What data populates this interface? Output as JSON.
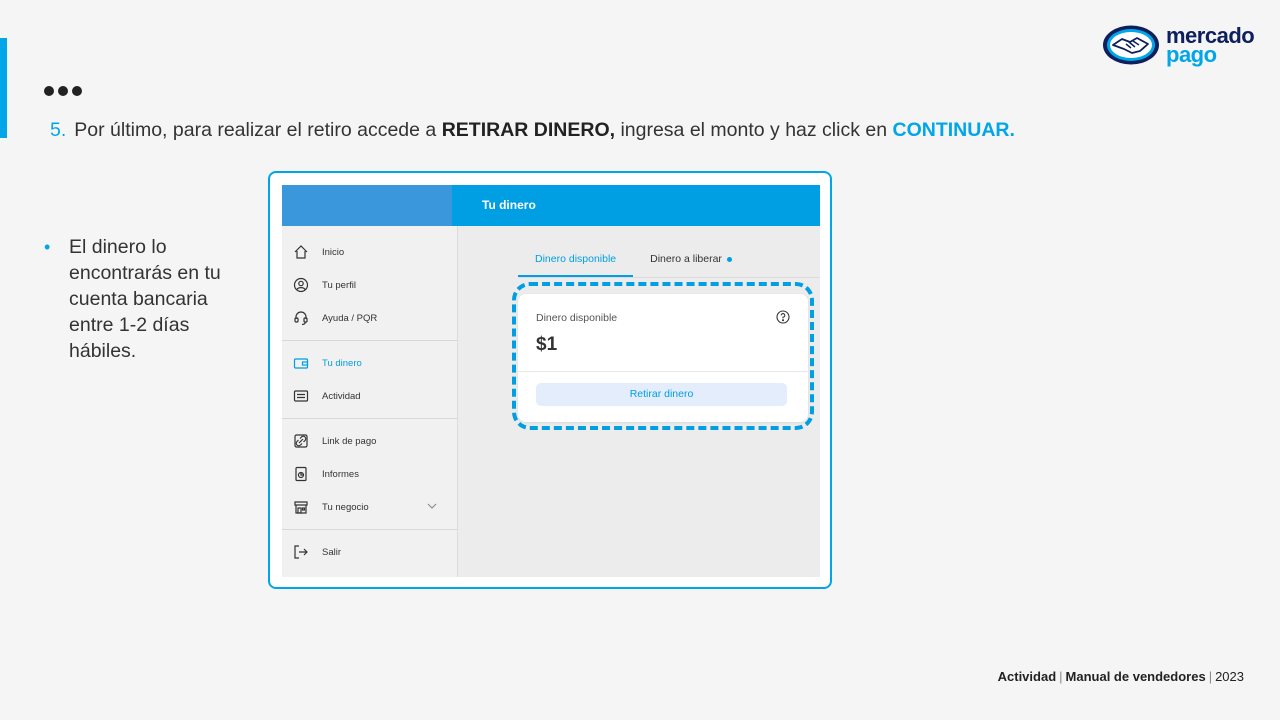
{
  "brand": {
    "line1": "mercado",
    "line2": "pago",
    "logo_icon": "handshake-icon",
    "accent_color": "#00a6e8",
    "navy_color": "#0d1f5c"
  },
  "step": {
    "number": "5.",
    "text_before": "Por último, para realizar el retiro accede a ",
    "bold_text": "RETIRAR DINERO,",
    "text_middle": " ingresa el monto y haz click en ",
    "highlight_text": "CONTINUAR."
  },
  "note": {
    "bullet": "•",
    "text": "El dinero lo encontrarás en tu cuenta bancaria entre 1-2 días hábiles."
  },
  "app": {
    "header_title": "Tu dinero",
    "sidebar": {
      "items": [
        {
          "label": "Inicio",
          "icon": "home-icon"
        },
        {
          "label": "Tu perfil",
          "icon": "user-icon"
        },
        {
          "label": "Ayuda / PQR",
          "icon": "headset-icon"
        },
        {
          "label": "Tu dinero",
          "icon": "wallet-icon"
        },
        {
          "label": "Actividad",
          "icon": "list-icon"
        },
        {
          "label": "Link de pago",
          "icon": "link-icon"
        },
        {
          "label": "Informes",
          "icon": "report-icon"
        },
        {
          "label": "Tu negocio",
          "icon": "store-icon"
        },
        {
          "label": "Salir",
          "icon": "logout-icon"
        }
      ],
      "active": "Tu dinero"
    },
    "tabs": [
      {
        "label": "Dinero disponible",
        "active": true
      },
      {
        "label": "Dinero a liberar",
        "active": false
      }
    ],
    "card": {
      "label": "Dinero disponible",
      "amount": "$1",
      "button_label": "Retirar dinero"
    }
  },
  "footer": {
    "section": "Actividad",
    "manual": "Manual de vendedores",
    "year": "2023"
  }
}
